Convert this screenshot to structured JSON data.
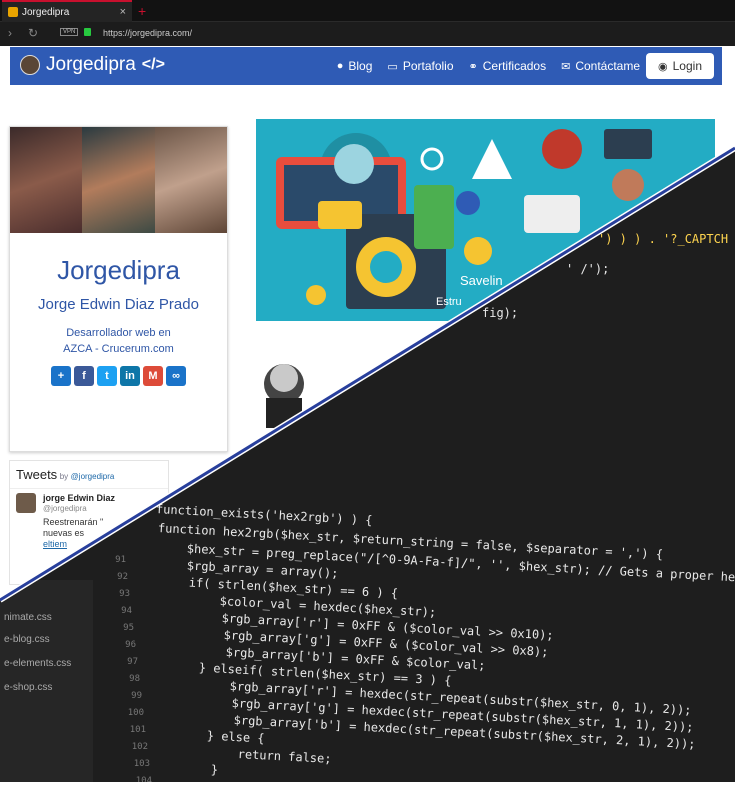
{
  "browser": {
    "tab_title": "Jorgedipra",
    "tab_close": "×",
    "new_tab": "+",
    "vpn_label": "VPN",
    "url": "https://jorgedipra.com/"
  },
  "nav": {
    "brand": "Jorgedipra",
    "brand_code": "</>",
    "items": [
      {
        "label": "Blog",
        "icon": "blogger-icon"
      },
      {
        "label": "Portafolio",
        "icon": "monitor-icon"
      },
      {
        "label": "Certificados",
        "icon": "link-icon"
      },
      {
        "label": "Contáctame",
        "icon": "envelope-icon"
      }
    ],
    "login": "Login"
  },
  "profile": {
    "name": "Jorgedipra",
    "full_name": "Jorge Edwin Diaz Prado",
    "desc_line1": "Desarrollador web en",
    "desc_line2": "AZCA - Crucerum.com"
  },
  "share": [
    {
      "label": "+",
      "color": "#1a73c9"
    },
    {
      "label": "f",
      "color": "#3b5998"
    },
    {
      "label": "t",
      "color": "#1da1f2"
    },
    {
      "label": "in",
      "color": "#0e76a8"
    },
    {
      "label": "M",
      "color": "#dd4b39"
    },
    {
      "label": "∞",
      "color": "#1a73c9"
    }
  ],
  "tweets": {
    "title": "Tweets",
    "by": "by",
    "handle": "@jorgedipra",
    "author": "jorge Edwin Diaz",
    "author_handle": "@jorgedipra",
    "text": "Reestrenarán \"",
    "text2": "nuevas es",
    "link": "eltiem"
  },
  "banner": {
    "text1": "Savelin",
    "text2": "Estru"
  },
  "code": {
    "line_numbers": [
      "91",
      "92",
      "93",
      "94",
      "95",
      "96",
      "97",
      "98",
      "99",
      "100",
      "101",
      "102",
      "103",
      "104"
    ],
    "lines": [
      "function_exists('hex2rgb') ) {",
      "function hex2rgb($hex_str, $return_string = false, $separator = ',') {",
      "    $hex_str = preg_replace(\"/[^0-9A-Fa-f]/\", '', $hex_str); // Gets a proper hex s",
      "    $rgb_array = array();",
      "    if( strlen($hex_str) == 6 ) {",
      "        $color_val = hexdec($hex_str);",
      "        $rgb_array['r'] = 0xFF & ($color_val >> 0x10);",
      "        $rgb_array['g'] = 0xFF & ($color_val >> 0x8);",
      "        $rgb_array['b'] = 0xFF & $color_val;",
      "    } elseif( strlen($hex_str) == 3 ) {",
      "        $rgb_array['r'] = hexdec(str_repeat(substr($hex_str, 0, 1), 2));",
      "        $rgb_array['g'] = hexdec(str_repeat(substr($hex_str, 1, 1), 2));",
      "        $rgb_array['b'] = hexdec(str_repeat(substr($hex_str, 2, 1), 2));",
      "    } else {",
      "        return false;",
      "    }"
    ],
    "snippet_top1": "') ) ) . '?_CAPTCH",
    "snippet_top2": "' /');",
    "snippet_top3": "fig);",
    "files": [
      "nimate.css",
      "e-blog.css",
      "e-elements.css",
      "e-shop.css"
    ]
  }
}
